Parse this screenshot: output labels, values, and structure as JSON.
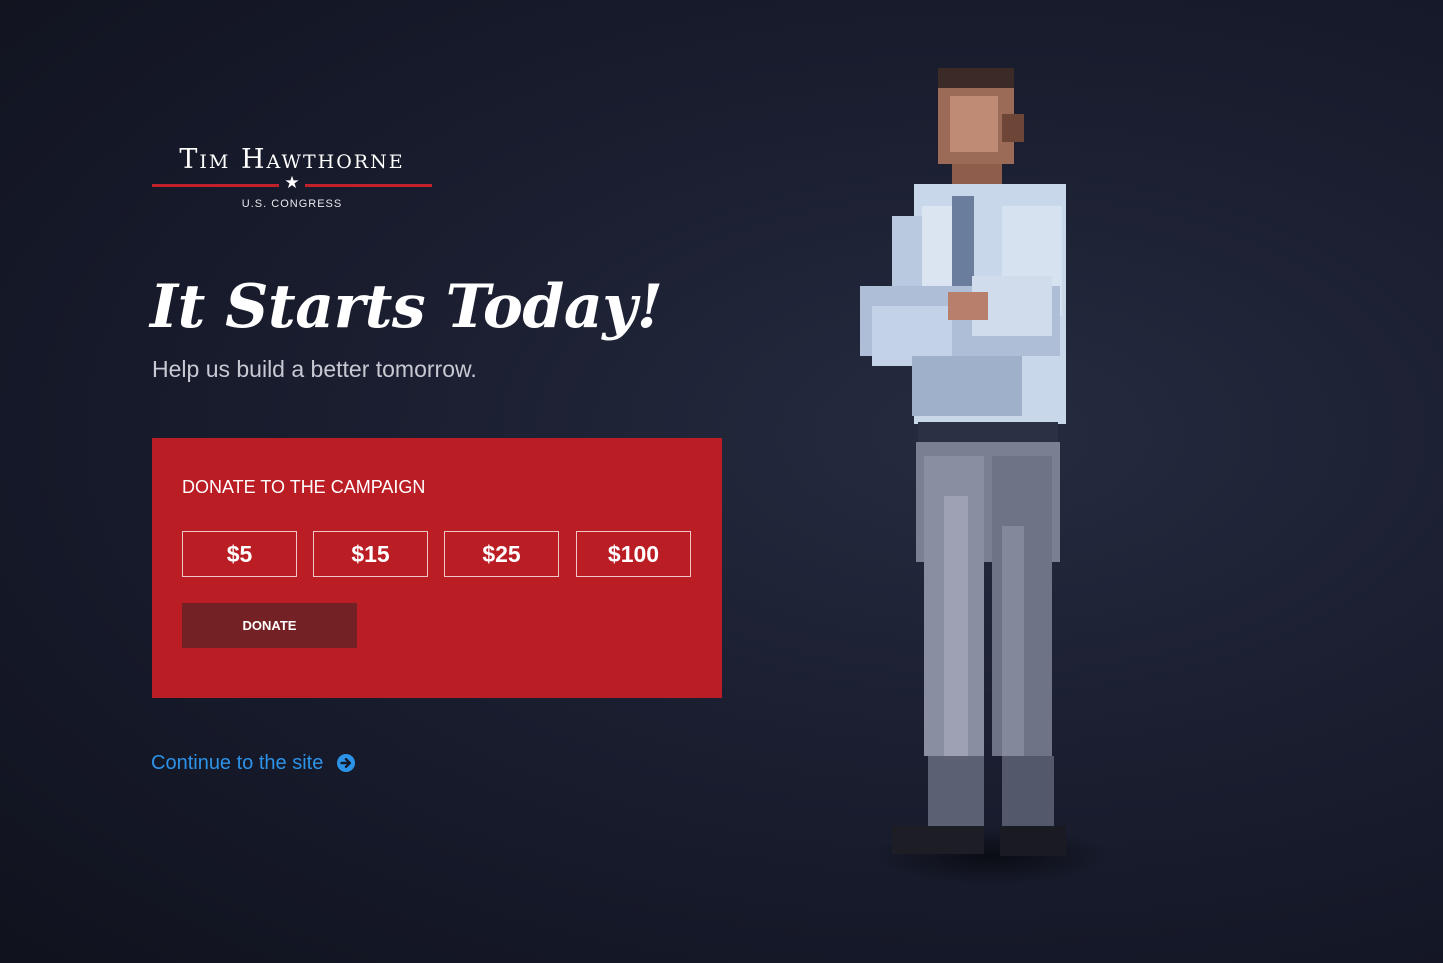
{
  "logo": {
    "name": "Tim Hawthorne",
    "star": "★",
    "subtitle": "U.S. CONGRESS"
  },
  "hero": {
    "headline": "It Starts Today!",
    "subheadline": "Help us build a better tomorrow."
  },
  "donate": {
    "title": "DONATE TO THE CAMPAIGN",
    "amounts": [
      "$5",
      "$15",
      "$25",
      "$100"
    ],
    "button_label": "DONATE"
  },
  "continue_link": {
    "label": "Continue to the site",
    "icon": "arrow-circle-right-icon"
  },
  "colors": {
    "brand_red": "#bb1d25",
    "donate_button": "#742126",
    "link_blue": "#2d93e8",
    "background": "#1b1f31"
  }
}
